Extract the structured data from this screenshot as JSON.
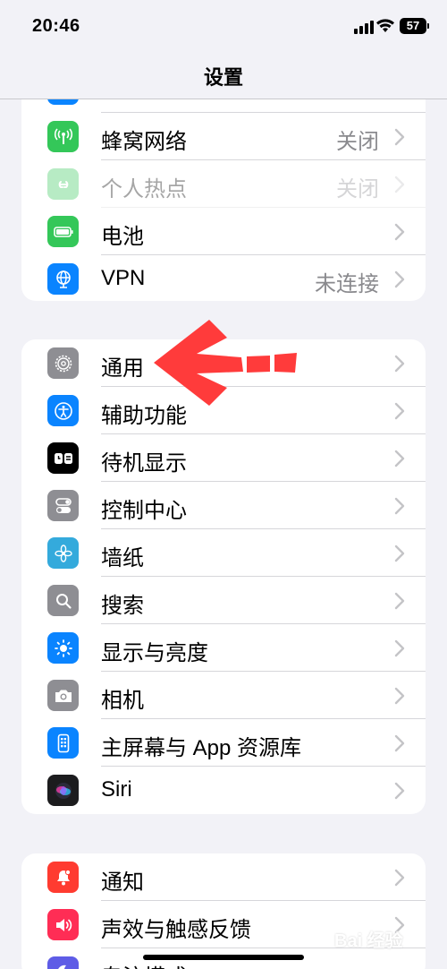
{
  "status_bar": {
    "time": "20:46",
    "battery": "57"
  },
  "header": {
    "title": "设置"
  },
  "groups": [
    {
      "rows": [
        {
          "label": "蜂窝网络",
          "value": "关闭",
          "icon": "cellular-icon",
          "color": "#34c759"
        },
        {
          "label": "个人热点",
          "value": "关闭",
          "icon": "hotspot-icon",
          "color": "#34c759",
          "disabled": true
        },
        {
          "label": "电池",
          "value": "",
          "icon": "battery-icon",
          "color": "#34c759"
        },
        {
          "label": "VPN",
          "value": "未连接",
          "icon": "vpn-globe-icon",
          "color": "#0a84ff"
        }
      ]
    },
    {
      "rows": [
        {
          "label": "通用",
          "icon": "gear-icon",
          "color": "#8e8e93"
        },
        {
          "label": "辅助功能",
          "icon": "accessibility-icon",
          "color": "#0a84ff"
        },
        {
          "label": "待机显示",
          "icon": "standby-icon",
          "color": "#000000"
        },
        {
          "label": "控制中心",
          "icon": "toggles-icon",
          "color": "#8e8e93"
        },
        {
          "label": "墙纸",
          "icon": "flower-icon",
          "color": "#34aadc"
        },
        {
          "label": "搜索",
          "icon": "search-icon",
          "color": "#8e8e93"
        },
        {
          "label": "显示与亮度",
          "icon": "sun-icon",
          "color": "#0a84ff"
        },
        {
          "label": "相机",
          "icon": "camera-icon",
          "color": "#8e8e93"
        },
        {
          "label": "主屏幕与 App 资源库",
          "icon": "home-screen-icon",
          "color": "#0a84ff"
        },
        {
          "label": "Siri",
          "icon": "siri-icon",
          "color": "#1c1c1e"
        }
      ]
    },
    {
      "rows": [
        {
          "label": "通知",
          "icon": "bell-icon",
          "color": "#ff3b30"
        },
        {
          "label": "声效与触感反馈",
          "icon": "speaker-icon",
          "color": "#ff2d55"
        },
        {
          "label": "专注模式",
          "icon": "moon-icon",
          "color": "#5e5ce6"
        }
      ]
    }
  ],
  "watermark": "Bai 经验",
  "annotation": {
    "arrow_color": "#ff3b3b",
    "points_to": "通用"
  }
}
